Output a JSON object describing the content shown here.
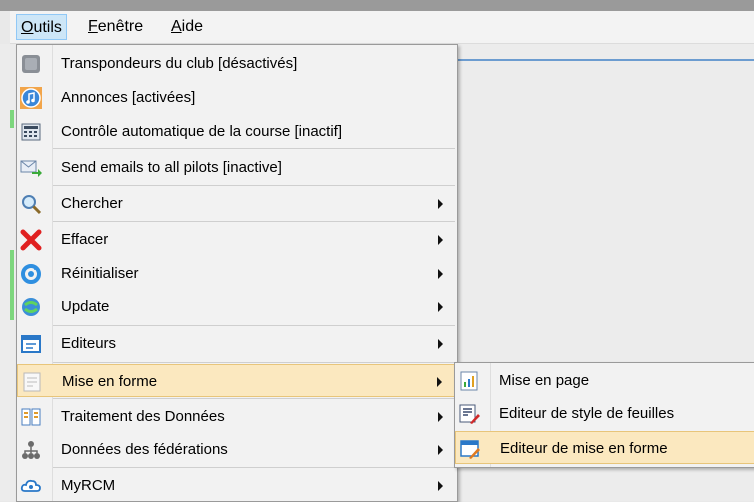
{
  "menubar": {
    "items": [
      {
        "label": "Outils",
        "mnemonic": "O",
        "rest": "utils"
      },
      {
        "label": "Fenêtre",
        "mnemonic": "F",
        "rest": "enêtre"
      },
      {
        "label": "Aide",
        "mnemonic": "A",
        "rest": "ide"
      }
    ]
  },
  "outils_menu": {
    "items": [
      {
        "label": "Transpondeurs du club [désactivés]",
        "icon": "transponder-icon",
        "submenu": false
      },
      {
        "label": "Annonces [activées]",
        "icon": "music-note-icon",
        "submenu": false
      },
      {
        "label": "Contrôle automatique de la course [inactif]",
        "icon": "calculator-icon",
        "submenu": false
      },
      {
        "label": "Send emails to all pilots [inactive]",
        "icon": "email-send-icon",
        "submenu": false
      },
      {
        "label": "Chercher",
        "icon": "magnifier-icon",
        "submenu": true
      },
      {
        "label": "Effacer",
        "icon": "red-x-icon",
        "submenu": true
      },
      {
        "label": "Réinitialiser",
        "icon": "refresh-icon",
        "submenu": true
      },
      {
        "label": "Update",
        "icon": "update-globe-icon",
        "submenu": true
      },
      {
        "label": "Editeurs",
        "icon": "editor-window-icon",
        "submenu": true
      },
      {
        "label": "Mise en forme",
        "icon": "layout-page-icon",
        "submenu": true,
        "highlighted": true
      },
      {
        "label": "Traitement des Données",
        "icon": "data-processing-icon",
        "submenu": true
      },
      {
        "label": "Données des fédérations",
        "icon": "federation-hierarchy-icon",
        "submenu": true
      },
      {
        "label": "MyRCM",
        "icon": "cloud-icon",
        "submenu": true
      }
    ]
  },
  "mise_en_forme_submenu": {
    "items": [
      {
        "label": "Mise en page",
        "icon": "page-chart-icon"
      },
      {
        "label": "Editeur de style de feuilles",
        "icon": "style-editor-icon"
      },
      {
        "label": "Editeur de mise en forme",
        "icon": "layout-editor-icon",
        "highlighted": true
      }
    ]
  },
  "colors": {
    "highlight_bg": "#fbe8bf",
    "highlight_border": "#e8c57a",
    "menu_bg": "#f2f2f2",
    "menubar_active_bg": "#cde6f7"
  }
}
